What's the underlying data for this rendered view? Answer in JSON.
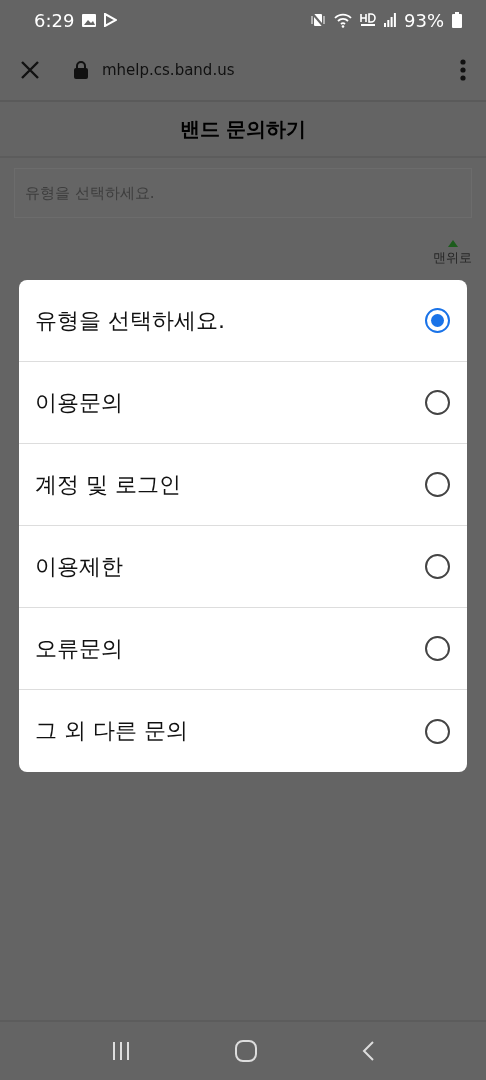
{
  "status_bar": {
    "time": "6:29",
    "battery": "93%"
  },
  "browser_bar": {
    "url": "mhelp.cs.band.us"
  },
  "page": {
    "title": "밴드 문의하기",
    "select": {
      "placeholder": "유형을 선택하세요."
    },
    "top_link": "맨위로"
  },
  "dialog": {
    "options": [
      {
        "label": "유형을 선택하세요.",
        "selected": true
      },
      {
        "label": "이용문의",
        "selected": false
      },
      {
        "label": "계정 및 로그인",
        "selected": false
      },
      {
        "label": "이용제한",
        "selected": false
      },
      {
        "label": "오류문의",
        "selected": false
      },
      {
        "label": "그 외 다른 문의",
        "selected": false
      }
    ]
  }
}
